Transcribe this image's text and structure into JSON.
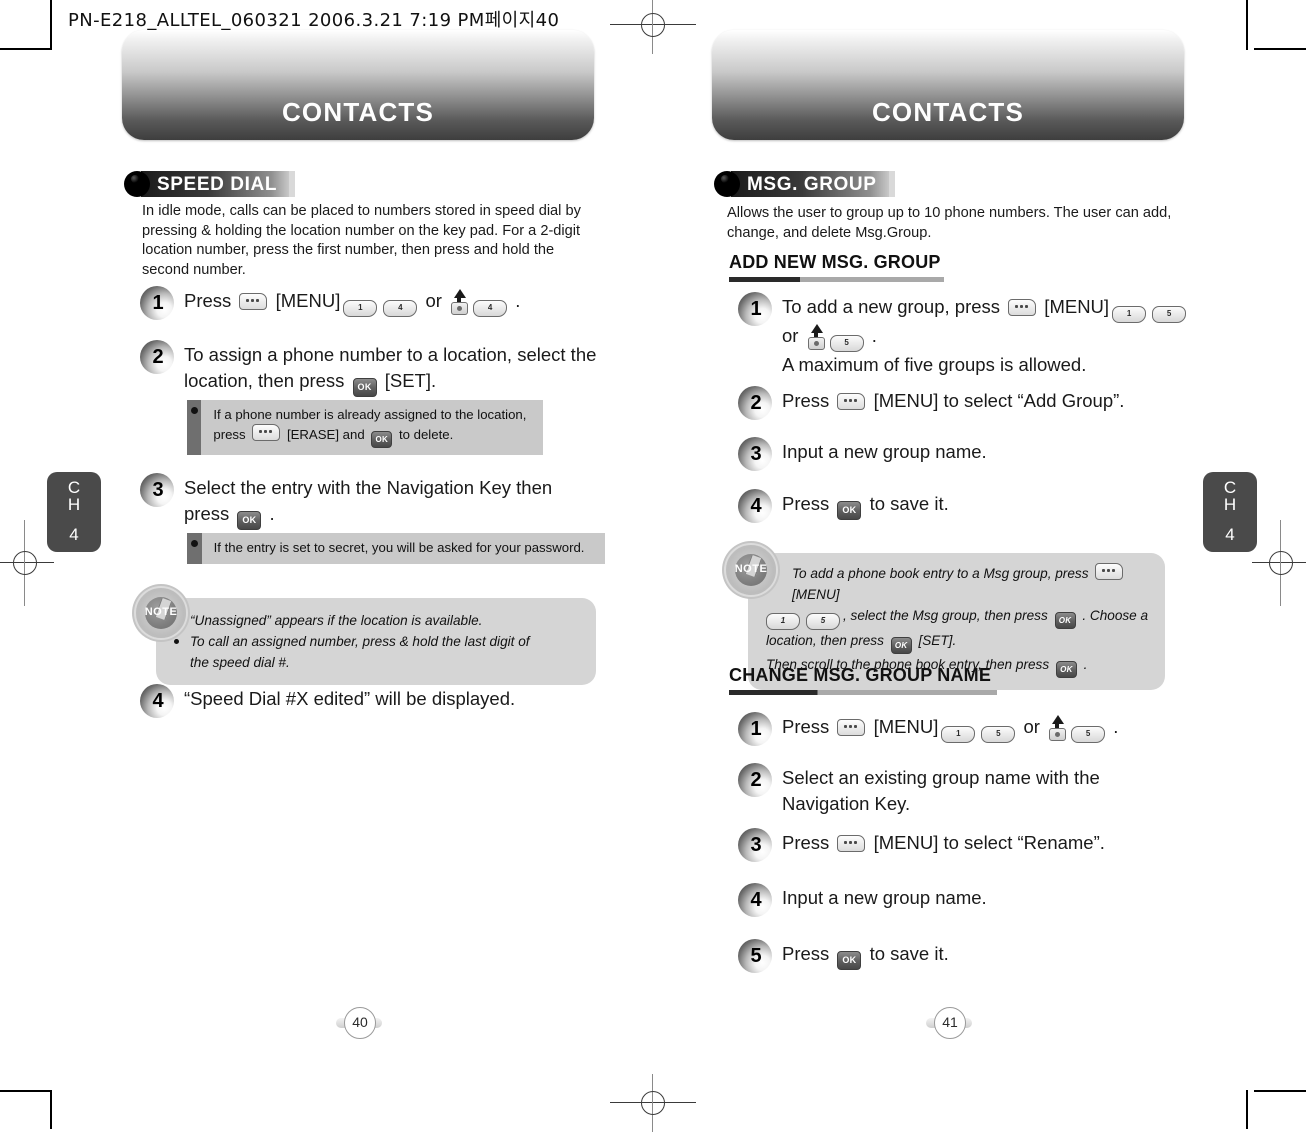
{
  "print_slug": "PN-E218_ALLTEL_060321  2006.3.21 7:19 PM페이지40",
  "left_page": {
    "banner_title": "CONTACTS",
    "chapter_tab": {
      "line1": "C",
      "line2": "H",
      "line3": "4"
    },
    "page_number": "40",
    "section": {
      "label": "SPEED DIAL"
    },
    "intro": "In idle mode, calls can be placed to numbers stored in speed dial by pressing & holding the location number on the key pad. For a 2-digit location number, press the first number, then press and hold the second number.",
    "steps": [
      {
        "num": "1",
        "pre": "Press ",
        "mid": " [MENU]",
        "post": " or ",
        "end": " ."
      },
      {
        "num": "2",
        "pre": "To assign a phone number to a location, select the location, then press ",
        "post": "  [SET]."
      },
      {
        "num": "3",
        "pre": "Select the entry with the Navigation Key then press ",
        "post": " ."
      },
      {
        "num": "4",
        "pre": "“Speed Dial #X edited” will be displayed."
      }
    ],
    "infobox_1": {
      "part1": "If a phone number is already assigned to the location, press ",
      "part2": " [ERASE] and ",
      "part3": " to delete."
    },
    "infobox_2": {
      "text": "If the entry is set to secret, you will be asked for your password."
    },
    "note": {
      "icon_label": "NOTE",
      "items": [
        "“Unassigned” appears if the location is available.",
        "To call an assigned number, press & hold the last digit of the speed dial #."
      ]
    },
    "keys": {
      "soft": "soft-key",
      "num_1": "1",
      "num_4": "4",
      "ok": "OK"
    }
  },
  "right_page": {
    "banner_title": "CONTACTS",
    "chapter_tab": {
      "line1": "C",
      "line2": "H",
      "line3": "4"
    },
    "page_number": "41",
    "section": {
      "label": "MSG. GROUP"
    },
    "intro": "Allows the user to group up to 10 phone numbers. The user can add, change, and delete Msg.Group.",
    "subhead_1": "ADD NEW MSG. GROUP",
    "steps_add": [
      {
        "num": "1",
        "pre": "To add a new group, press ",
        "mid": " [MENU]",
        "post": "or ",
        "end": " .",
        "extra": "A maximum of five groups is allowed."
      },
      {
        "num": "2",
        "pre": "Press ",
        "post": " [MENU] to select “Add Group”."
      },
      {
        "num": "3",
        "pre": "Input a new group name."
      },
      {
        "num": "4",
        "pre": "Press ",
        "post": "  to save it."
      }
    ],
    "note": {
      "icon_label": "NOTE",
      "l1a": "To add a phone book entry to a Msg group, press ",
      "l1b": " [MENU]",
      "l2a": ", select the Msg group, then press ",
      "l2b": " . Choose a",
      "l3a": "location, then press ",
      "l3b": "  [SET].",
      "l4a": "Then scroll to the phone book entry, then press ",
      "l4b": " ."
    },
    "subhead_2": "CHANGE MSG. GROUP NAME",
    "steps_change": [
      {
        "num": "1",
        "pre": "Press ",
        "mid": " [MENU]",
        "post": " or ",
        "end": " ."
      },
      {
        "num": "2",
        "pre": "Select an existing group name with the Navigation Key."
      },
      {
        "num": "3",
        "pre": "Press ",
        "post": " [MENU] to select “Rename”."
      },
      {
        "num": "4",
        "pre": "Input a new group name."
      },
      {
        "num": "5",
        "pre": "Press ",
        "post": "  to save it."
      }
    ],
    "keys": {
      "soft": "soft-key",
      "num_1": "1",
      "num_5": "5",
      "ok": "OK"
    }
  }
}
